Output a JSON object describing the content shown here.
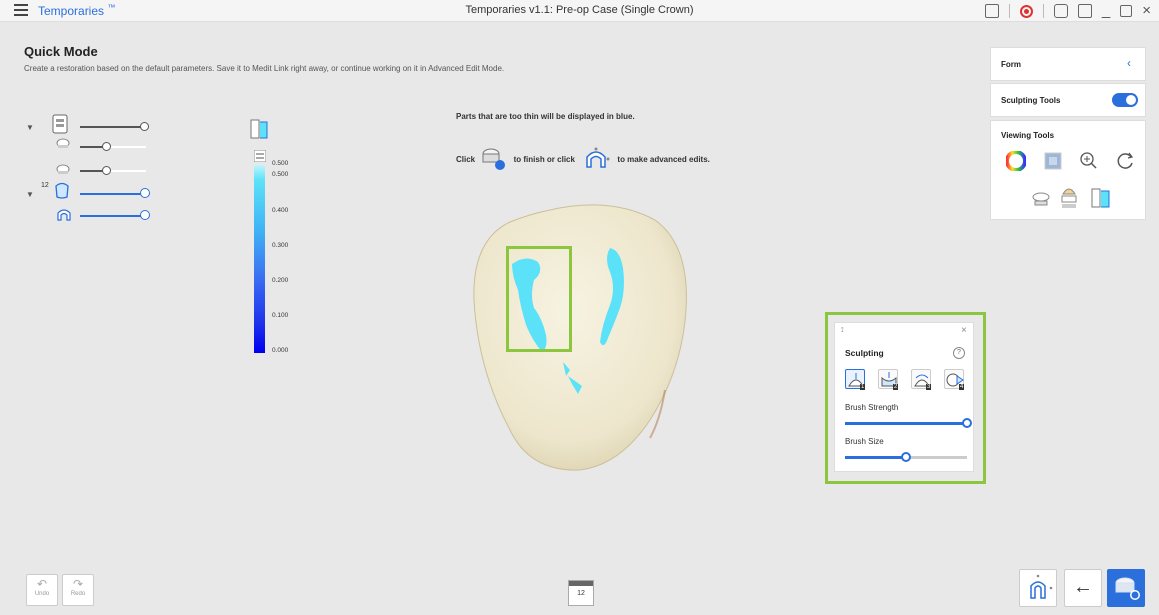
{
  "titlebar": {
    "app_name": "Temporaries",
    "app_sup": "™",
    "window_title": "Temporaries v1.1: Pre-op Case (Single Crown)"
  },
  "header": {
    "title": "Quick Mode",
    "description": "Create a restoration based on the default parameters. Save it to Medit Link right away, or continue working on it in Advanced Edit Mode."
  },
  "tree": {
    "tooth_number": "12"
  },
  "color_bar": {
    "labels": [
      "0.500",
      "0.500",
      "0.400",
      "0.300",
      "0.200",
      "0.100",
      "0.000"
    ]
  },
  "hint": {
    "line1": "Parts that are too thin will be displayed in blue.",
    "click": "Click",
    "finish_or_click": "to finish or click",
    "advanced": "to make advanced edits."
  },
  "right_panel": {
    "form_label": "Form",
    "sculpting_tools_label": "Sculpting Tools",
    "sculpting_tools_on": true,
    "viewing_tools_label": "Viewing Tools"
  },
  "sculpting": {
    "title": "Sculpting",
    "help": "?",
    "brush_numbers": [
      "1",
      "2",
      "3",
      "4"
    ],
    "brush_strength_label": "Brush Strength",
    "brush_strength_level": 1.0,
    "brush_size_label": "Brush Size",
    "brush_size_level": 0.5
  },
  "bottom": {
    "undo_label": "Undo",
    "redo_label": "Redo",
    "calendar_day": "12"
  },
  "colors": {
    "accent": "#2a6fdb",
    "highlight": "#8cc63f",
    "thin_area": "#5ce2f8",
    "tooth": "#f1ecd8"
  }
}
